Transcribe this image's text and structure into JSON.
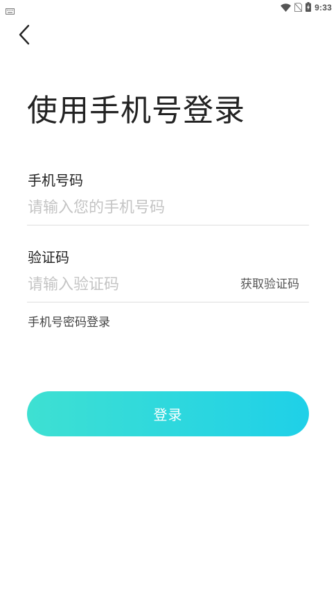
{
  "status_bar": {
    "time": "9:33",
    "icons": [
      "keyboard-icon",
      "wifi-icon",
      "no-sim-icon",
      "battery-charging-icon"
    ]
  },
  "header": {
    "back_icon": "chevron-left-icon",
    "title": "使用手机号登录"
  },
  "form": {
    "phone": {
      "label": "手机号码",
      "value": "",
      "placeholder": "请输入您的手机号码"
    },
    "code": {
      "label": "验证码",
      "value": "",
      "placeholder": "请输入验证码",
      "get_code_label": "获取验证码"
    },
    "password_login_link": "手机号密码登录",
    "submit_label": "登录"
  },
  "colors": {
    "button_gradient_start": "#3ee0d2",
    "button_gradient_end": "#1fd0e8",
    "text_primary": "#222222",
    "placeholder": "#c4c4c4",
    "divider": "#dedede"
  }
}
